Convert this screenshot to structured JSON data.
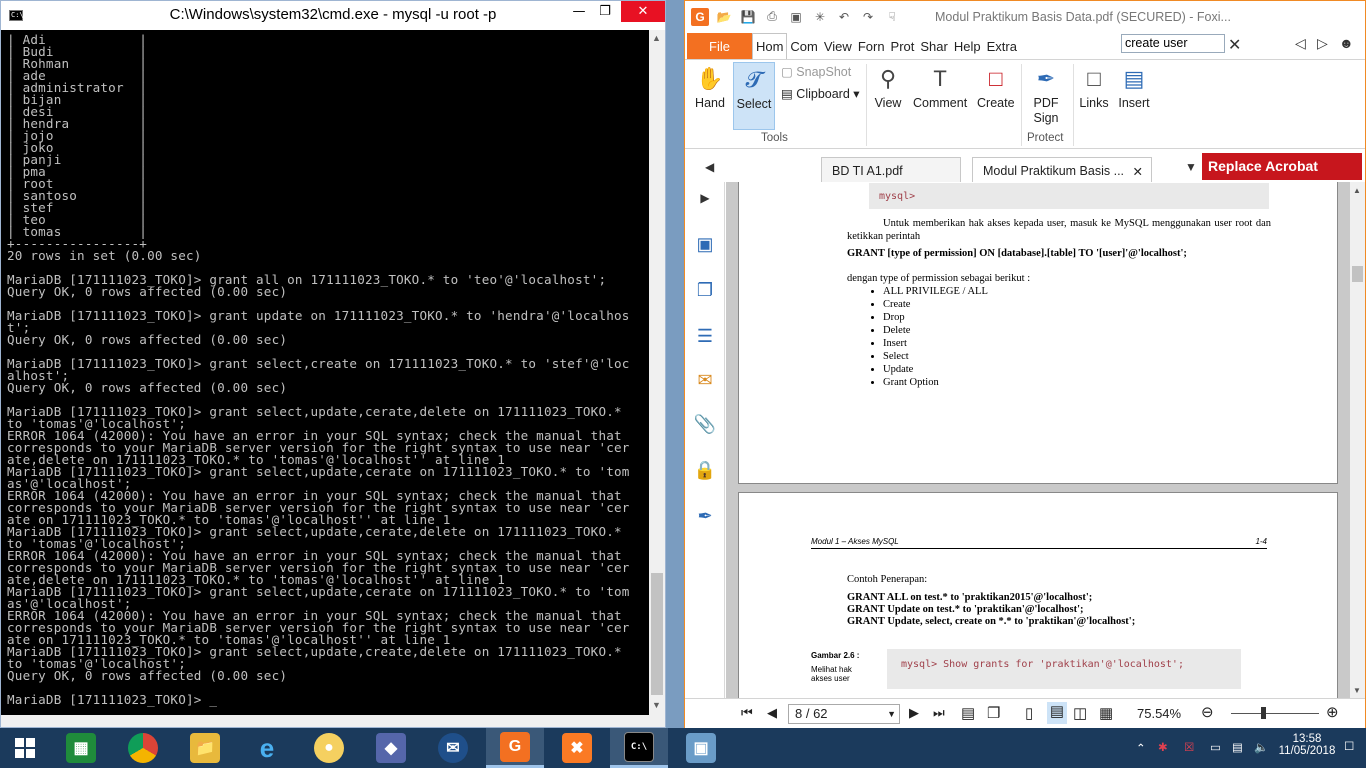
{
  "cmd": {
    "title": "C:\\Windows\\system32\\cmd.exe - mysql  -u root -p",
    "lines": [
      "| Adi            |",
      "| Budi           |",
      "| Rohman         |",
      "| ade            |",
      "| administrator  |",
      "| bijan          |",
      "| desi           |",
      "| hendra         |",
      "| jojo           |",
      "| joko           |",
      "| panji          |",
      "| pma            |",
      "| root           |",
      "| santoso        |",
      "| stef           |",
      "| teo            |",
      "| tomas          |",
      "+----------------+",
      "20 rows in set (0.00 sec)",
      "",
      "MariaDB [171111023_TOKO]> grant all on 171111023_TOKO.* to 'teo'@'localhost';",
      "Query OK, 0 rows affected (0.00 sec)",
      "",
      "MariaDB [171111023_TOKO]> grant update on 171111023_TOKO.* to 'hendra'@'localhos",
      "t';",
      "Query OK, 0 rows affected (0.00 sec)",
      "",
      "MariaDB [171111023_TOKO]> grant select,create on 171111023_TOKO.* to 'stef'@'loc",
      "alhost';",
      "Query OK, 0 rows affected (0.00 sec)",
      "",
      "MariaDB [171111023_TOKO]> grant select,update,cerate,delete on 171111023_TOKO.*",
      "to 'tomas'@'localhost';",
      "ERROR 1064 (42000): You have an error in your SQL syntax; check the manual that",
      "corresponds to your MariaDB server version for the right syntax to use near 'cer",
      "ate,delete on 171111023_TOKO.* to 'tomas'@'localhost'' at line 1",
      "MariaDB [171111023_TOKO]> grant select,update,cerate on 171111023_TOKO.* to 'tom",
      "as'@'localhost';",
      "ERROR 1064 (42000): You have an error in your SQL syntax; check the manual that",
      "corresponds to your MariaDB server version for the right syntax to use near 'cer",
      "ate on 171111023_TOKO.* to 'tomas'@'localhost'' at line 1",
      "MariaDB [171111023_TOKO]> grant select,update,cerate,delete on 171111023_TOKO.*",
      "to 'tomas'@'localhost';",
      "ERROR 1064 (42000): You have an error in your SQL syntax; check the manual that",
      "corresponds to your MariaDB server version for the right syntax to use near 'cer",
      "ate,delete on 171111023_TOKO.* to 'tomas'@'localhost'' at line 1",
      "MariaDB [171111023_TOKO]> grant select,update,cerate on 171111023_TOKO.* to 'tom",
      "as'@'localhost';",
      "ERROR 1064 (42000): You have an error in your SQL syntax; check the manual that",
      "corresponds to your MariaDB server version for the right syntax to use near 'cer",
      "ate on 171111023_TOKO.* to 'tomas'@'localhost'' at line 1",
      "MariaDB [171111023_TOKO]> grant select,update,create,delete on 171111023_TOKO.*",
      "to 'tomas'@'localhost';",
      "Query OK, 0 rows affected (0.00 sec)",
      "",
      "MariaDB [171111023_TOKO]> _"
    ]
  },
  "foxit": {
    "title": "Modul Praktikum Basis Data.pdf (SECURED) - Foxi...",
    "tabs": [
      "File",
      "Hom",
      "Com",
      "View",
      "Forn",
      "Prot",
      "Shar",
      "Help",
      "Extra"
    ],
    "search_value": "create user",
    "ribbon": {
      "hand": "Hand",
      "select": "Select",
      "snapshot": "SnapShot",
      "clipboard": "Clipboard",
      "view": "View",
      "comment": "Comment",
      "create": "Create",
      "pdf_sign": "PDF Sign",
      "links": "Links",
      "insert": "Insert",
      "tools_group": "Tools",
      "protect_group": "Protect"
    },
    "doc_tabs": [
      "BD TI A1.pdf",
      "Modul Praktikum Basis ..."
    ],
    "replace_acrobat": "Replace Acrobat",
    "page1": {
      "code_top": "mysql>",
      "intro": "Untuk memberikan hak akses kepada user, masuk ke MySQL menggunakan user root dan ketikkan perintah",
      "grant_syntax": "GRANT [type of permission] ON [database].[table] TO '[user]'@'localhost';",
      "types_intro": "dengan type of permission sebagai berikut :",
      "types": [
        "ALL PRIVILEGE / ALL",
        "Create",
        "Drop",
        "Delete",
        "Insert",
        "Select",
        "Update",
        "Grant Option"
      ]
    },
    "page2": {
      "header_left": "Modul 1 – Akses MySQL",
      "header_right": "1-4",
      "example_title": "Contoh Penerapan:",
      "examples": [
        "GRANT ALL on test.* to 'praktikan2015'@'localhost';",
        "GRANT Update on test.* to 'praktikan'@'localhost';",
        "GRANT Update, select, create on *.* to 'praktikan'@'localhost';"
      ],
      "figure_label": "Gambar 2.6 :",
      "figure_caption": "Melihat hak akses user",
      "figure_code": "mysql> Show grants for 'praktikan'@'localhost';"
    },
    "status": {
      "page_value": "8 / 62",
      "zoom": "75.54%"
    }
  },
  "taskbar": {
    "time": "13:58",
    "date": "11/05/2018"
  },
  "colors": {
    "foxit_orange": "#f37021",
    "replace_red": "#c7161d",
    "taskbar": "#1b3a5c",
    "console_bg": "#000000",
    "console_fg": "#c0c0c0"
  }
}
